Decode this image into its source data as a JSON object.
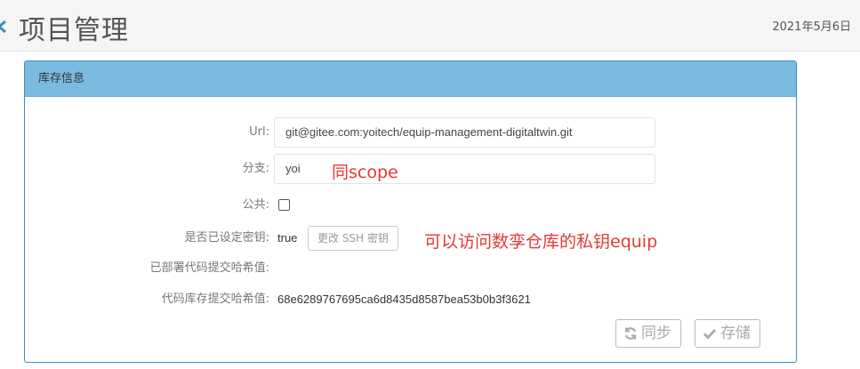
{
  "header": {
    "title": "项目管理",
    "date": "2021年5月6日"
  },
  "panel": {
    "heading": "库存信息",
    "fields": {
      "url_label": "Url:",
      "url_value": "git@gitee.com:yoitech/equip-management-digitaltwin.git",
      "branch_label": "分支:",
      "branch_value": "yoi",
      "public_label": "公共:",
      "key_label": "是否已设定密钥:",
      "key_value": "true",
      "ssh_button": "更改 SSH 密钥",
      "deployed_hash_label": "已部署代码提交哈希值:",
      "repo_hash_label": "代码库存提交哈希值:",
      "repo_hash_value": "68e6289767695ca6d8435d8587bea53b0b3f3621"
    },
    "buttons": {
      "sync": "同步",
      "save": "存储"
    }
  },
  "annotations": {
    "branch_note": "同scope",
    "key_note": "可以访问数孪仓库的私钥equip"
  },
  "icons": {
    "back": "chevron-left-icon",
    "sync": "refresh-icon",
    "save": "check-icon"
  },
  "colors": {
    "panel_heading_bg": "#7cbbe0",
    "panel_border": "#3c8dbc",
    "annotation": "#e53935"
  }
}
